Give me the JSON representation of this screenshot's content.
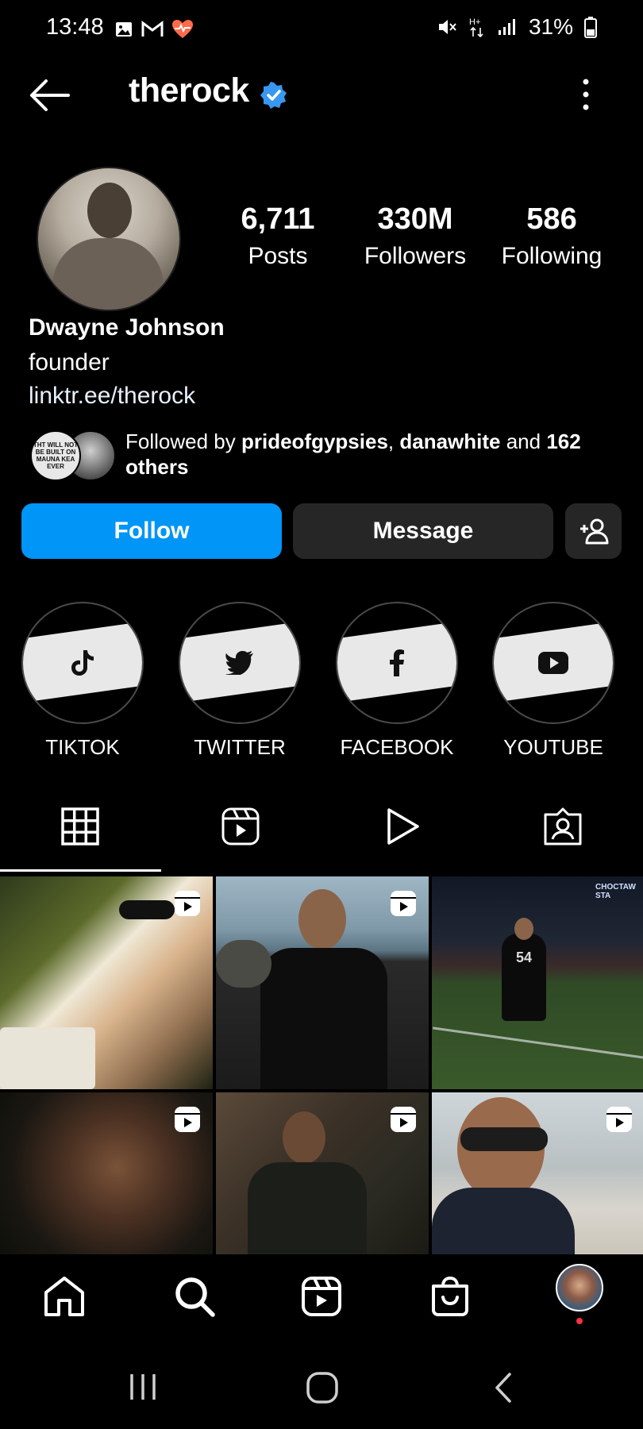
{
  "status_bar": {
    "time": "13:48",
    "battery": "31%"
  },
  "header": {
    "username": "therock"
  },
  "profile": {
    "stats": [
      {
        "value": "6,711",
        "label": "Posts"
      },
      {
        "value": "330M",
        "label": "Followers"
      },
      {
        "value": "586",
        "label": "Following"
      }
    ],
    "name": "Dwayne Johnson",
    "bio": "founder",
    "link": "linktr.ee/therock",
    "followed_by": {
      "prefix": "Followed by ",
      "user1": "prideofgypsies",
      "sep": ", ",
      "user2": "danawhite",
      "mid": " and ",
      "count": "162 others"
    },
    "mutual_avatar_text": "THT WILL NOT BE BUILT ON MAUNA KEA EVER"
  },
  "actions": {
    "follow": "Follow",
    "message": "Message"
  },
  "highlights": [
    {
      "label": "TIKTOK",
      "icon": "tiktok-icon"
    },
    {
      "label": "TWITTER",
      "icon": "twitter-icon"
    },
    {
      "label": "FACEBOOK",
      "icon": "facebook-icon"
    },
    {
      "label": "YOUTUBE",
      "icon": "youtube-icon"
    }
  ],
  "tabs": [
    "grid-icon",
    "reels-icon",
    "video-icon",
    "tagged-icon"
  ],
  "grid": [
    {
      "type": "reel",
      "scene": "pouring-tequila"
    },
    {
      "type": "reel",
      "scene": "beach-tank-top"
    },
    {
      "type": "photo",
      "scene": "football-field",
      "jersey": "54",
      "sign": "CHOCTAW STA"
    },
    {
      "type": "reel",
      "scene": "closeup-dark"
    },
    {
      "type": "reel",
      "scene": "black-adam-suit"
    },
    {
      "type": "reel",
      "scene": "sunglasses-selfie"
    }
  ],
  "colors": {
    "accent": "#0095f6",
    "button_dark": "#262626",
    "verified": "#3897f0"
  }
}
